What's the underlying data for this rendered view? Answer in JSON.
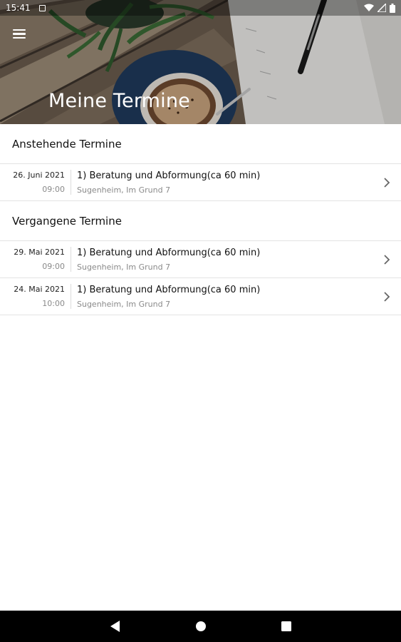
{
  "status_bar": {
    "time": "15:41",
    "icons": [
      "notification-icon",
      "wifi-icon",
      "signal-icon",
      "battery-icon"
    ]
  },
  "header": {
    "menu_icon": "hamburger-menu-icon",
    "title": "Meine Termine"
  },
  "upcoming": {
    "heading": "Anstehende Termine",
    "items": [
      {
        "date": "26. Juni 2021",
        "time": "09:00",
        "title": "1) Beratung und Abformung(ca 60 min)",
        "location": "Sugenheim, Im Grund 7"
      }
    ]
  },
  "past": {
    "heading": "Vergangene Termine",
    "items": [
      {
        "date": "29. Mai 2021",
        "time": "09:00",
        "title": "1) Beratung und Abformung(ca 60 min)",
        "location": "Sugenheim, Im Grund 7"
      },
      {
        "date": "24. Mai 2021",
        "time": "10:00",
        "title": "1) Beratung und Abformung(ca 60 min)",
        "location": "Sugenheim, Im Grund 7"
      }
    ]
  },
  "nav_bar": {
    "buttons": [
      "back-icon",
      "home-icon",
      "recents-icon"
    ]
  },
  "colors": {
    "divider": "#e3e3e3",
    "secondary_text": "#8a8a8a",
    "nav_bg": "#000000"
  }
}
